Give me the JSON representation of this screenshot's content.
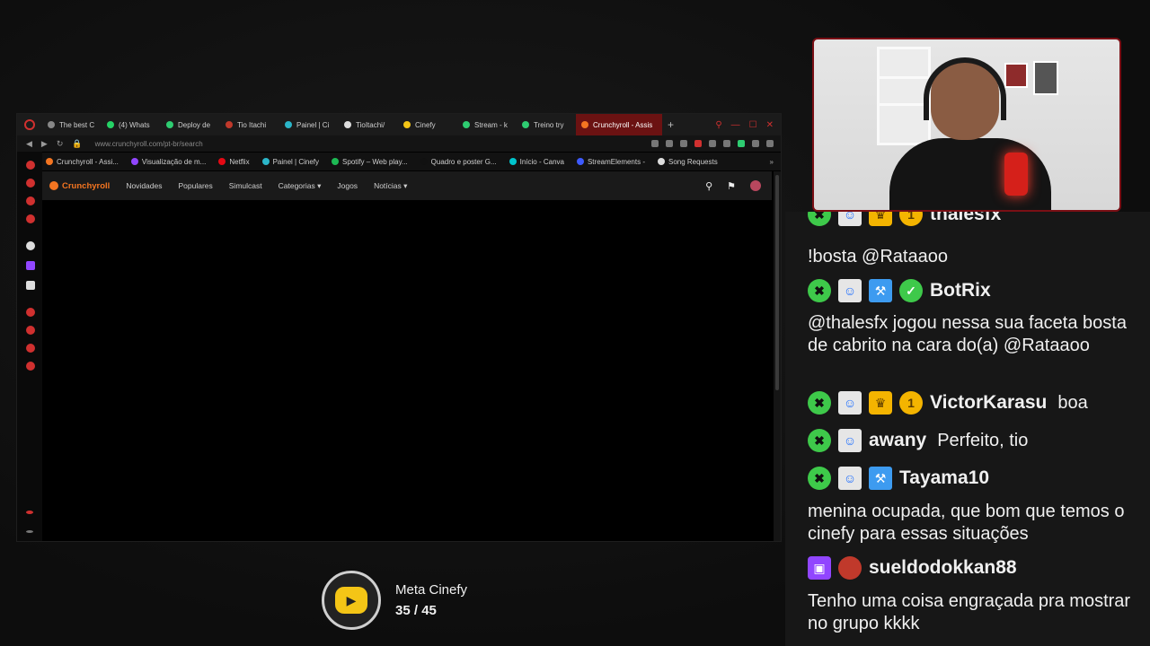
{
  "browser": {
    "tabs": [
      {
        "label": "The best C",
        "color": "#888888"
      },
      {
        "label": "(4) Whats",
        "color": "#25d366"
      },
      {
        "label": "Deploy de",
        "color": "#2ecc71"
      },
      {
        "label": "Tio Itachi",
        "color": "#c0392b"
      },
      {
        "label": "Painel | Ci",
        "color": "#2bb5c8"
      },
      {
        "label": "TioItachi/",
        "color": "#dddddd"
      },
      {
        "label": "Cinefy",
        "color": "#f4c516"
      },
      {
        "label": "Stream - k",
        "color": "#2ecc71"
      },
      {
        "label": "Treino try",
        "color": "#2ecc71"
      }
    ],
    "active_tab": {
      "label": "Crunchyroll - Assis",
      "color": "#f47521"
    },
    "url": "www.crunchyroll.com/pt-br/search",
    "bookmarks": [
      {
        "label": "Crunchyroll - Assi...",
        "color": "#f47521"
      },
      {
        "label": "Visualização de m...",
        "color": "#9146ff"
      },
      {
        "label": "Netflix",
        "color": "#e50914"
      },
      {
        "label": "Painel | Cinefy",
        "color": "#2bb5c8"
      },
      {
        "label": "Spotify – Web play...",
        "color": "#1db954"
      },
      {
        "label": "Quadro e poster G...",
        "color": "#111111"
      },
      {
        "label": "Início - Canva",
        "color": "#00c4cc"
      },
      {
        "label": "StreamElements -",
        "color": "#3d5afe"
      },
      {
        "label": "Song Requests",
        "color": "#dddddd"
      }
    ],
    "crunchyroll": {
      "logo": "Crunchyroll",
      "nav": [
        "Novidades",
        "Populares",
        "Simulcast",
        "Categorias",
        "Jogos",
        "Notícias"
      ]
    }
  },
  "meta": {
    "title": "Meta Cinefy",
    "current": "35",
    "separator": "/",
    "goal": "45"
  },
  "chat": {
    "messages": [
      {
        "user": "thalesfx",
        "badges": [
          "mod",
          "bot",
          "crown",
          "coin"
        ],
        "text": ""
      },
      {
        "user": "",
        "badges": [],
        "text": "!bosta @Rataaoo"
      },
      {
        "user": "BotRix",
        "badges": [
          "mod",
          "bot",
          "hammer",
          "verified"
        ],
        "text": ""
      },
      {
        "user": "",
        "badges": [],
        "text": "@thalesfx jogou nessa sua faceta bosta de cabrito na cara do(a) @Rataaoo"
      },
      {
        "user": "VictorKarasu",
        "badges": [
          "mod",
          "bot",
          "crown",
          "coin"
        ],
        "text": "boa"
      },
      {
        "user": "awany",
        "badges": [
          "mod",
          "bot"
        ],
        "text": "Perfeito, tio"
      },
      {
        "user": "Tayama10",
        "badges": [
          "mod",
          "bot",
          "hammer"
        ],
        "text": ""
      },
      {
        "user": "",
        "badges": [],
        "text": "menina ocupada, que bom que temos o cinefy para essas situações"
      },
      {
        "user": "sueldodokkan88",
        "badges": [
          "twitch",
          "avatar"
        ],
        "text": ""
      },
      {
        "user": "",
        "badges": [],
        "text": "Tenho uma coisa engraçada pra mostrar no grupo kkkk"
      }
    ]
  },
  "colors": {
    "crunchyroll_orange": "#f47521",
    "mod_green": "#3ec94a",
    "webcam_border": "#7a0f15"
  }
}
